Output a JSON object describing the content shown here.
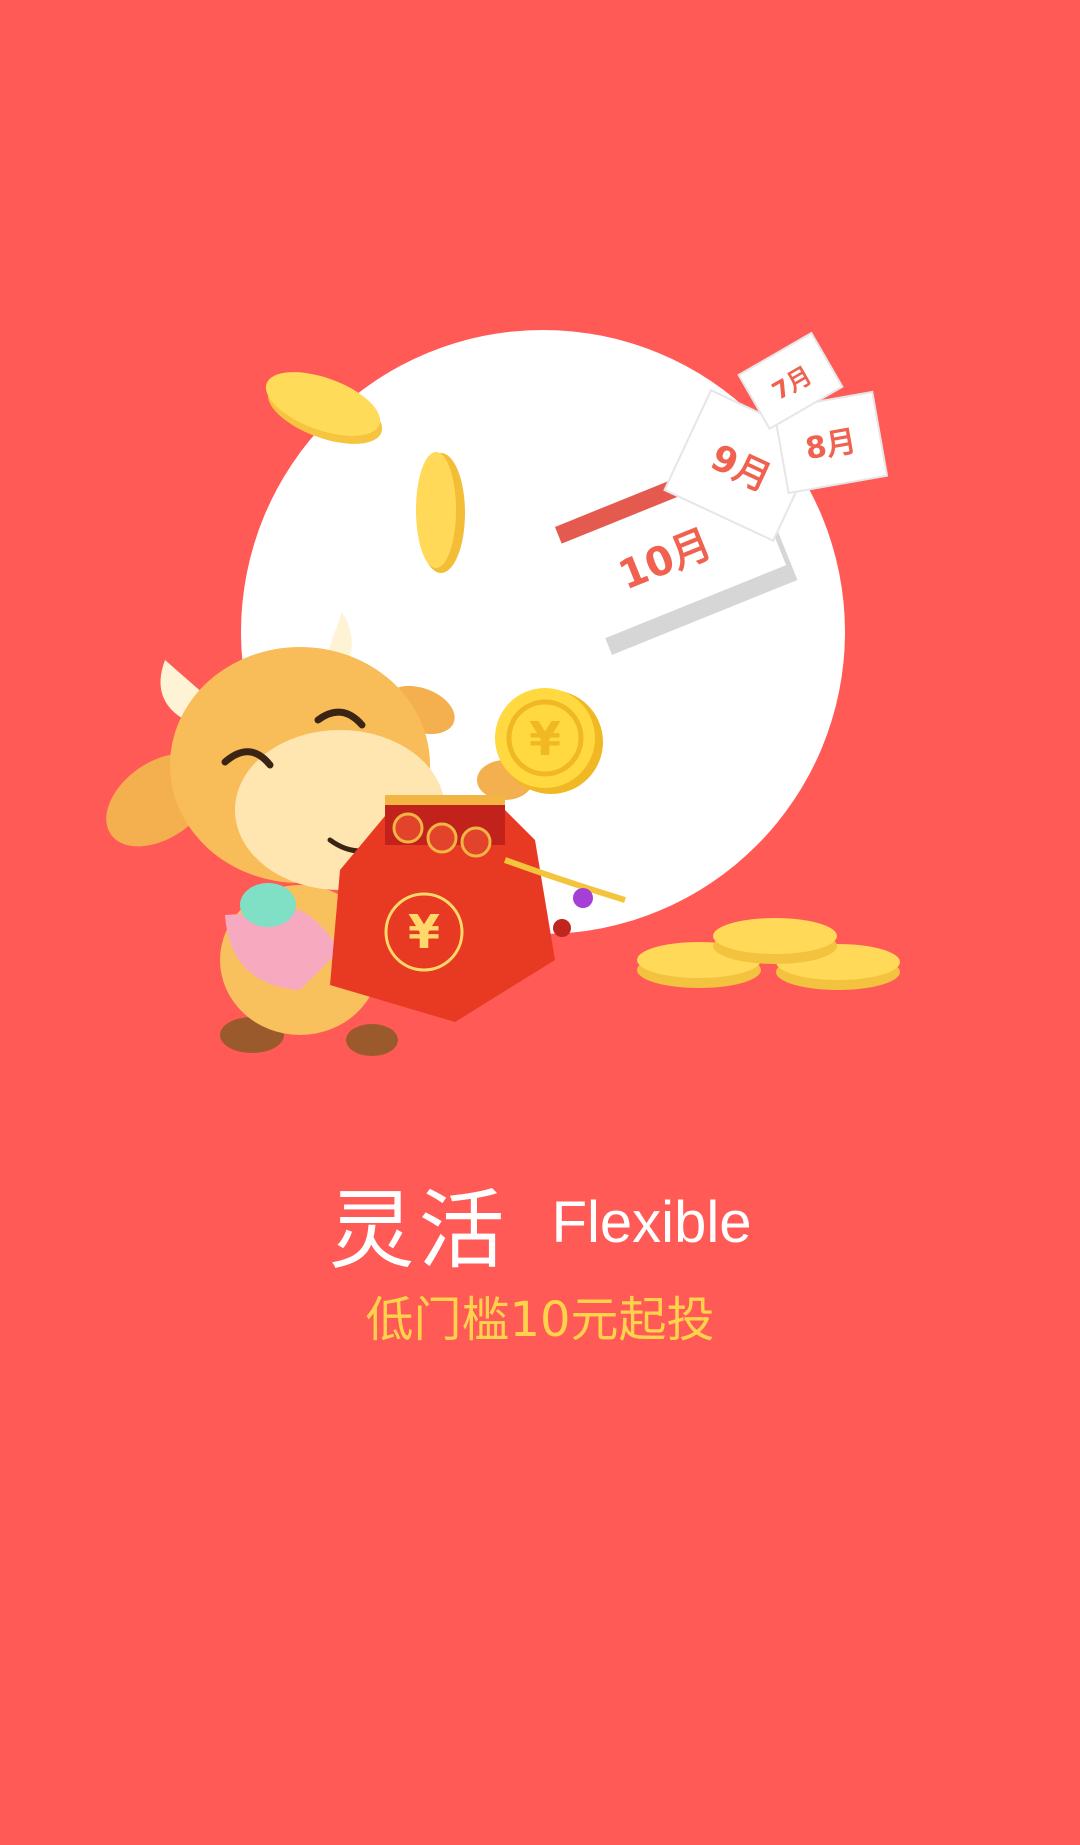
{
  "onboarding": {
    "title_cn": "灵活",
    "title_en": "Flexible",
    "subtitle": "低门槛10元起投"
  },
  "illustration": {
    "calendar_pages": [
      "10月",
      "9月",
      "8月",
      "7月"
    ],
    "coin_symbol": "¥",
    "bag_symbol": "¥"
  },
  "colors": {
    "background": "#FF5A56",
    "circle": "#FFFFFF",
    "subtitle": "#FFD24C",
    "coin": "#FFD24C"
  }
}
